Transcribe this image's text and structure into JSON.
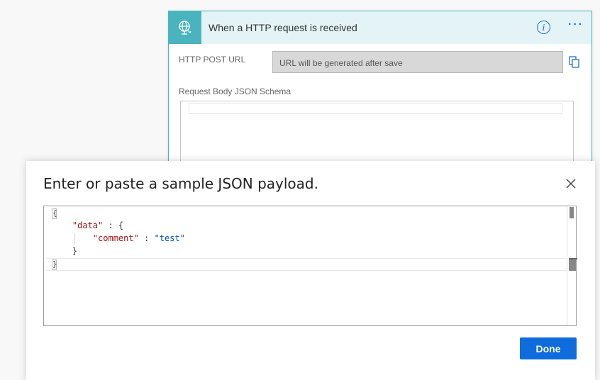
{
  "trigger": {
    "title": "When a HTTP request is received",
    "icon": "globe-request-icon",
    "url_label": "HTTP POST URL",
    "url_placeholder": "URL will be generated after save",
    "schema_label": "Request Body JSON Schema",
    "accent_color": "#49b4be"
  },
  "modal": {
    "title": "Enter or paste a sample JSON payload.",
    "code_lines": [
      "{",
      "    \"data\" : {",
      "        \"comment\" : \"test\"",
      "    }",
      "}"
    ],
    "done_label": "Done",
    "button_color": "#0f6cdc"
  }
}
